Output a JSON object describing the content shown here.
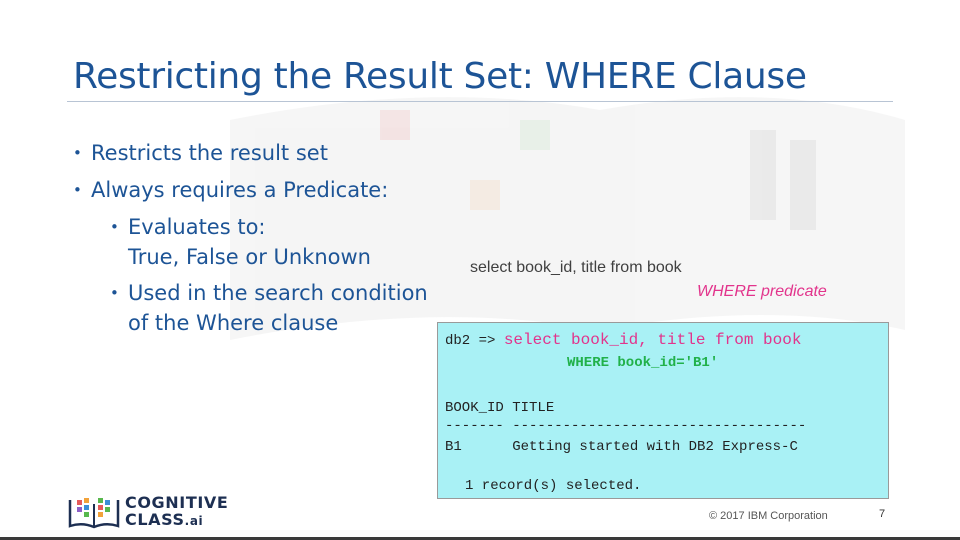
{
  "slide": {
    "title": "Restricting the Result Set: WHERE Clause",
    "bullets": [
      {
        "level": 1,
        "text": "Restricts the result set"
      },
      {
        "level": 1,
        "text": "Always requires a Predicate:"
      },
      {
        "level": 2,
        "lines": [
          "Evaluates to:",
          "True, False or Unknown"
        ]
      },
      {
        "level": 2,
        "lines": [
          "Used in the search condition",
          "of the Where clause"
        ]
      }
    ],
    "syntax": {
      "line1": "select book_id, title from book",
      "where_kw": "WHERE",
      "where_rest": " predicate"
    },
    "console": {
      "prompt": "db2 => ",
      "command": "select book_id, title from book",
      "where_line": "WHERE book_id='B1'",
      "header": "BOOK_ID TITLE",
      "separator": "------- -----------------------------------",
      "row": "B1      Getting started with DB2 Express-C",
      "footer": "1 record(s) selected."
    },
    "logo": {
      "line1": "COGNITIVE",
      "line2": "CLASS",
      "suffix": ".ai"
    },
    "copyright": "© 2017 IBM Corporation",
    "page_number": "7",
    "colors": {
      "title": "#1d5496",
      "console_bg": "#a9f1f5",
      "sql_keyword": "#e2348c",
      "where_green": "#21b14a"
    }
  }
}
